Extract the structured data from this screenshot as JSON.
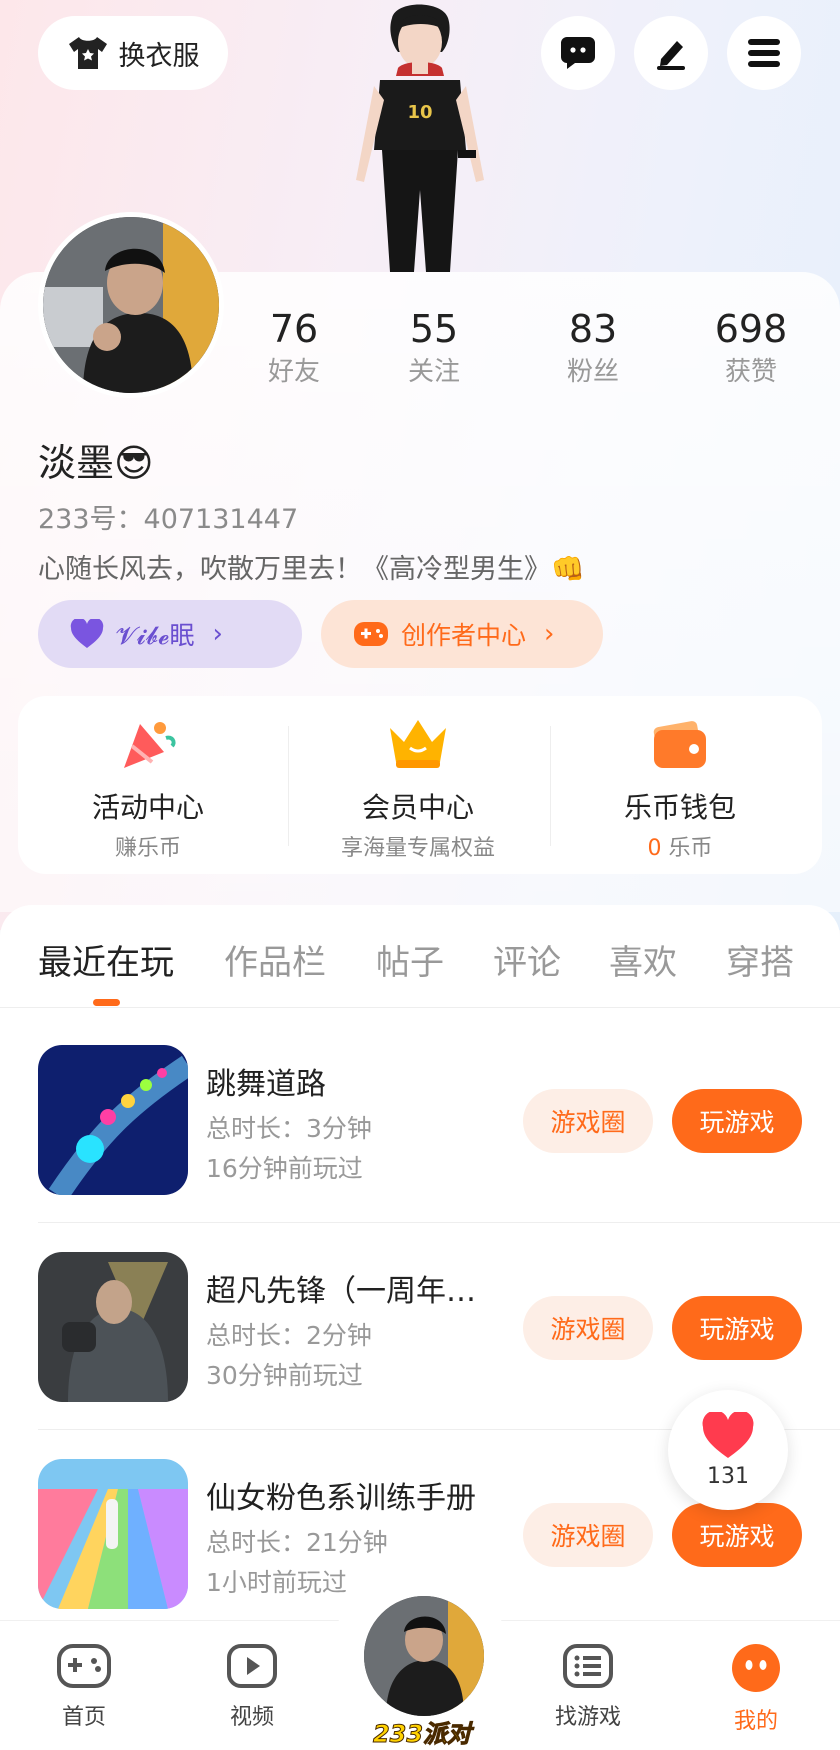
{
  "header": {
    "dress_button_label": "换衣服",
    "icons": [
      "chat-icon",
      "edit-icon",
      "menu-icon"
    ]
  },
  "profile": {
    "name": "淡墨😎",
    "uid_text": "233号：407131447",
    "bio": "心随长风去，吹散万里去！《高冷型男生》👊",
    "stats": [
      {
        "num": "76",
        "label": "好友"
      },
      {
        "num": "55",
        "label": "关注"
      },
      {
        "num": "83",
        "label": "粉丝"
      },
      {
        "num": "698",
        "label": "获赞"
      }
    ],
    "tag_left": "𝓥𝓲𝓫𝓮眠",
    "tag_right": "创作者中心"
  },
  "services": [
    {
      "title": "活动中心",
      "sub": "赚乐币"
    },
    {
      "title": "会员中心",
      "sub": "享海量专属权益"
    },
    {
      "title": "乐币钱包",
      "sub_num": "0",
      "sub": " 乐币"
    }
  ],
  "tabs": [
    "最近在玩",
    "作品栏",
    "帖子",
    "评论",
    "喜欢",
    "穿搭"
  ],
  "games": [
    {
      "name": "跳舞道路",
      "duration": "总时长：3分钟",
      "last": "16分钟前玩过"
    },
    {
      "name": "超凡先锋（一周年…",
      "duration": "总时长：2分钟",
      "last": "30分钟前玩过"
    },
    {
      "name": "仙女粉色系训练手册",
      "duration": "总时长：21分钟",
      "last": "1小时前玩过"
    }
  ],
  "game_buttons": {
    "circle": "游戏圈",
    "play": "玩游戏"
  },
  "like_count": "131",
  "nav": [
    {
      "label": "首页"
    },
    {
      "label": "视频"
    },
    {
      "label": "233派对"
    },
    {
      "label": "找游戏"
    },
    {
      "label": "我的"
    }
  ],
  "colors": {
    "accent": "#ff6a1a",
    "accent_soft": "#fdeee6"
  }
}
